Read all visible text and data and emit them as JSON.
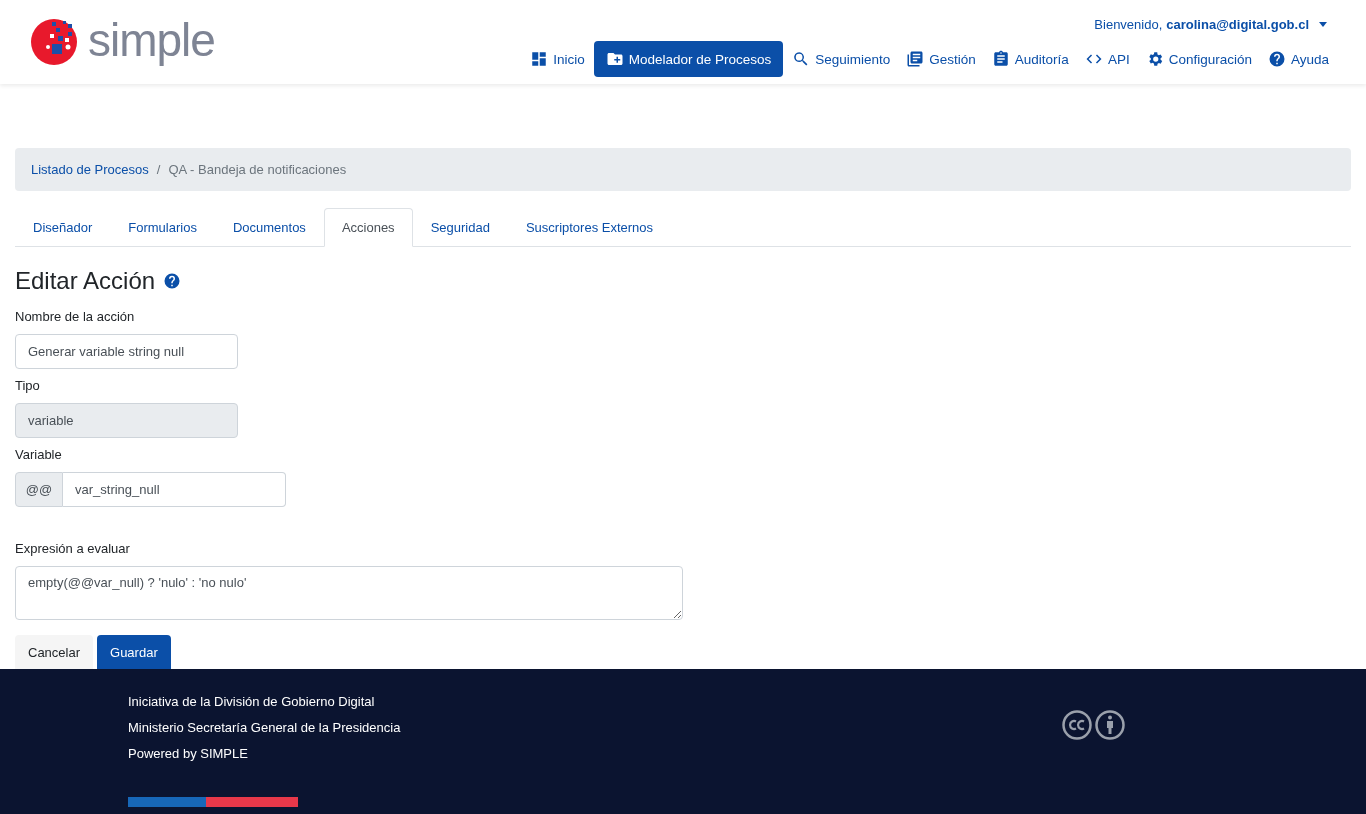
{
  "logo": {
    "text": "simple"
  },
  "user_menu": {
    "greeting": "Bienvenido,",
    "user": "carolina@digital.gob.cl"
  },
  "nav": [
    {
      "label": "Inicio",
      "selected": false
    },
    {
      "label": "Modelador de Procesos",
      "selected": true
    },
    {
      "label": "Seguimiento",
      "selected": false
    },
    {
      "label": "Gestión",
      "selected": false
    },
    {
      "label": "Auditoría",
      "selected": false
    },
    {
      "label": "API",
      "selected": false
    },
    {
      "label": "Configuración",
      "selected": false
    },
    {
      "label": "Ayuda",
      "selected": false
    }
  ],
  "breadcrumb": {
    "separator": "/",
    "items": [
      "Listado de Procesos",
      "QA - Bandeja de notificaciones"
    ]
  },
  "tabs": [
    {
      "label": "Diseñador",
      "selected": false
    },
    {
      "label": "Formularios",
      "selected": false
    },
    {
      "label": "Documentos",
      "selected": false
    },
    {
      "label": "Acciones",
      "selected": true
    },
    {
      "label": "Seguridad",
      "selected": false
    },
    {
      "label": "Suscriptores Externos",
      "selected": false
    }
  ],
  "form": {
    "title": "Editar Acción",
    "name_label": "Nombre de la acción",
    "name_value": "Generar variable string null",
    "type_label": "Tipo",
    "type_value": "variable",
    "variable_label": "Variable",
    "variable_prefix": "@@",
    "variable_value": "var_string_null",
    "expression_label": "Expresión a evaluar",
    "expression_value": "empty(@@var_null) ? 'nulo' : 'no nulo'",
    "buttons": [
      "Cancelar",
      "Guardar"
    ]
  },
  "footer": {
    "lines": [
      "Iniciativa de la División de Gobierno Digital",
      "Ministerio Secretaría General de la Presidencia",
      "Powered by SIMPLE"
    ]
  }
}
